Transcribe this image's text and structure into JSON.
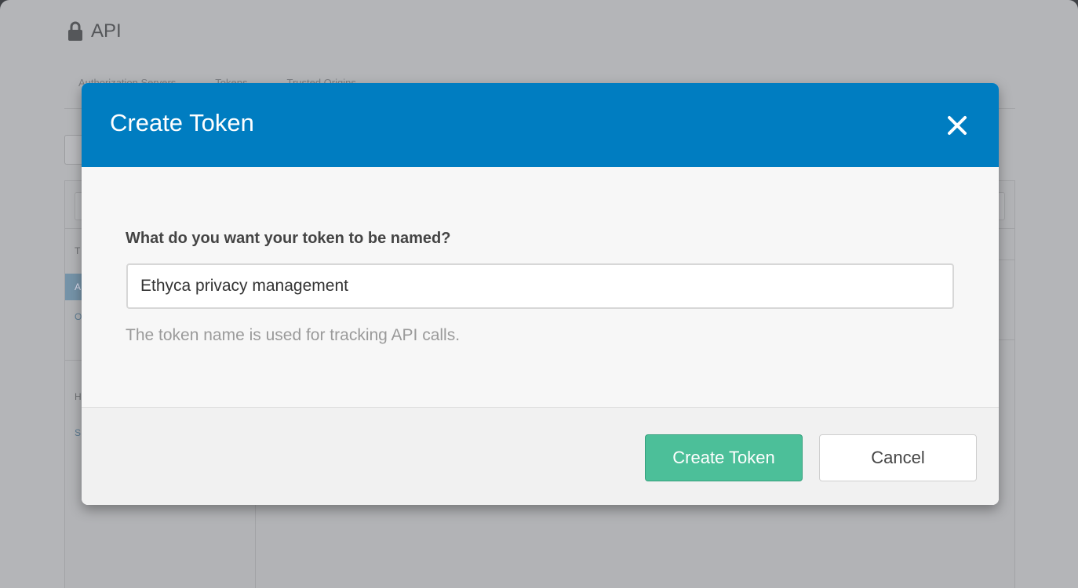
{
  "page": {
    "title": "API",
    "tabs": [
      {
        "label": "Authorization Servers"
      },
      {
        "label": "Tokens"
      },
      {
        "label": "Trusted Origins"
      }
    ],
    "sidebar": {
      "heading1": "T",
      "item_active": "A",
      "item_link": "O",
      "heading2": "H",
      "link2": "S"
    }
  },
  "modal": {
    "title": "Create Token",
    "field_label": "What do you want your token to be named?",
    "token_name_value": "Ethyca privacy management",
    "help_text": "The token name is used for tracking API calls.",
    "primary_button": "Create Token",
    "secondary_button": "Cancel"
  },
  "colors": {
    "header_blue": "#007dc1",
    "primary_green": "#4cbf99"
  },
  "icons": {
    "lock": "lock-icon",
    "close": "close-icon"
  }
}
